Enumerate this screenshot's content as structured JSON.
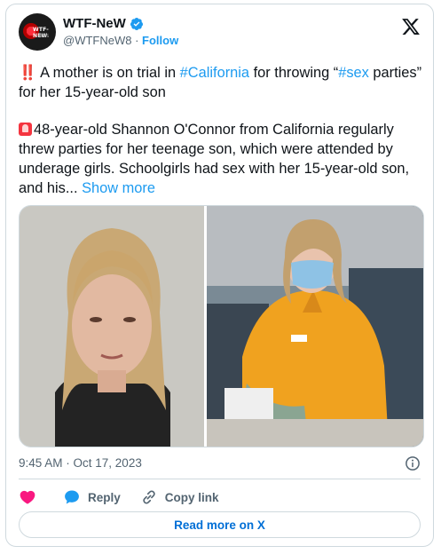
{
  "author": {
    "display_name": "WTF-NeW",
    "handle": "@WTFNeW8",
    "separator": " · ",
    "follow_label": "Follow",
    "avatar_text": "WTF-NEW",
    "avatar_subtext": "NEWS"
  },
  "tweet": {
    "line1_emoji": "‼️",
    "line1_pre": " A mother is on trial in ",
    "line1_hashtag": "#California",
    "line1_post": " for throwing “",
    "line1_hashtag2": "#sex",
    "line1_end": " parties” for her 15-year-old son",
    "para2": "48-year-old Shannon O'Connor from California regularly threw parties for her teenage son, which were attended by underage girls. Schoolgirls had sex with her 15-year-old son, and his...",
    "show_more": " Show more"
  },
  "timestamp": "9:45 AM · Oct 17, 2023",
  "actions": {
    "like_label": "",
    "reply_label": "Reply",
    "copy_label": "Copy link"
  },
  "read_more_label": "Read more on X",
  "colors": {
    "accent": "#1d9bf0",
    "like": "#f91880",
    "muted": "#536471",
    "verified": "#1d9bf0",
    "jumpsuit": "#f0a21f"
  },
  "icons": {
    "verified": "verified-badge-icon",
    "x_logo": "x-logo-icon",
    "info": "info-icon",
    "like": "heart-icon",
    "reply": "reply-bubble-icon",
    "copy": "link-icon"
  }
}
